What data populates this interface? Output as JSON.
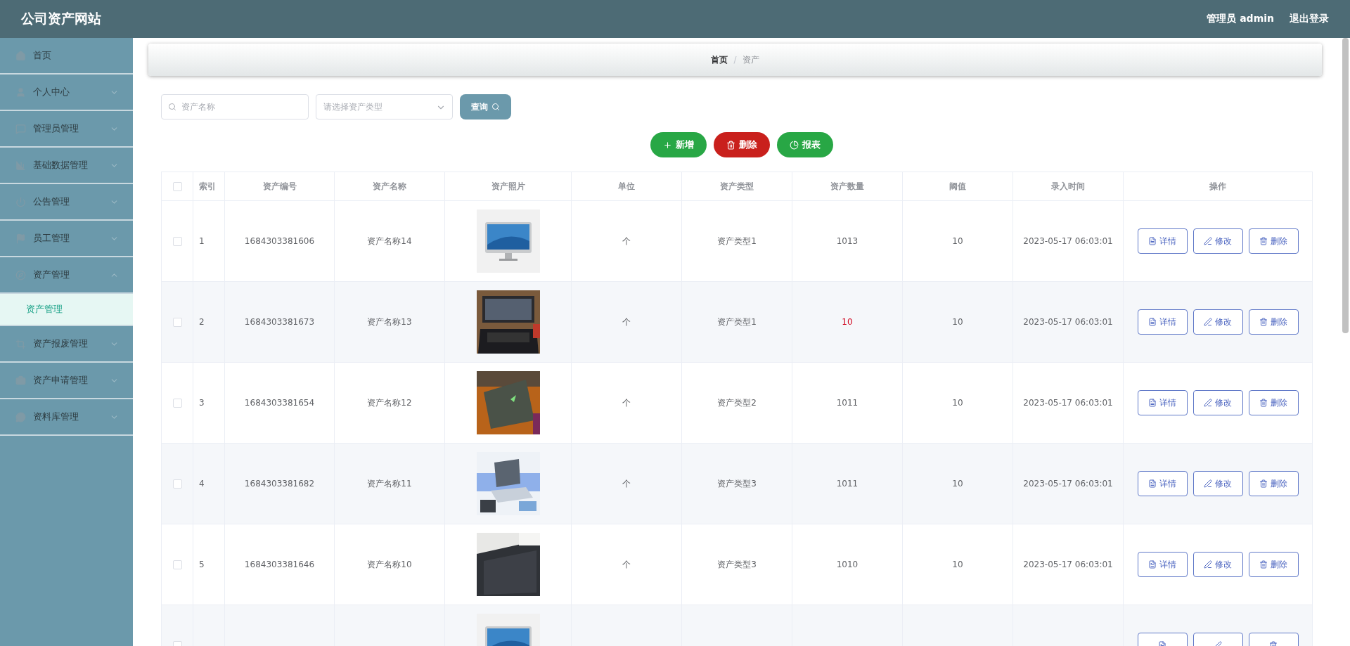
{
  "header": {
    "title": "公司资产网站",
    "user": "管理员 admin",
    "logout": "退出登录"
  },
  "sidebar": {
    "items": [
      {
        "kind": "home",
        "label": "首页"
      },
      {
        "kind": "user",
        "label": "个人中心",
        "expanded": false
      },
      {
        "kind": "chat",
        "label": "管理员管理",
        "expanded": false
      },
      {
        "kind": "chart",
        "label": "基础数据管理",
        "expanded": false
      },
      {
        "kind": "power",
        "label": "公告管理",
        "expanded": false
      },
      {
        "kind": "flag",
        "label": "员工管理",
        "expanded": false
      },
      {
        "kind": "compass",
        "label": "资产管理",
        "expanded": true,
        "children": [
          {
            "label": "资产管理",
            "selected": true
          }
        ]
      },
      {
        "kind": "crop",
        "label": "资产报废管理",
        "expanded": false
      },
      {
        "kind": "bag",
        "label": "资产申请管理",
        "expanded": false
      },
      {
        "kind": "message",
        "label": "资料库管理",
        "expanded": false
      }
    ]
  },
  "breadcrumb": {
    "items": [
      "首页",
      "资产"
    ],
    "separator": "/"
  },
  "search": {
    "name_placeholder": "资产名称",
    "type_placeholder": "请选择资产类型",
    "button": "查询"
  },
  "actions": [
    {
      "kind": "add",
      "label": "新增"
    },
    {
      "kind": "delete",
      "label": "删除"
    },
    {
      "kind": "report",
      "label": "报表"
    }
  ],
  "table": {
    "select_all_checked": false,
    "columns": [
      "索引",
      "资产编号",
      "资产名称",
      "资产照片",
      "单位",
      "资产类型",
      "资产数量",
      "阈值",
      "录入时间",
      "操作"
    ],
    "rows": [
      {
        "index": "1",
        "code": "1684303381606",
        "name": "资产名称14",
        "unit": "个",
        "type": "资产类型1",
        "quantity": "1013",
        "alert": false,
        "threshold": "10",
        "time": "2023-05-17 06:03:01",
        "checked": false,
        "buttons": [
          {
            "kind": "detail",
            "label": "详情"
          },
          {
            "kind": "edit",
            "label": "修改"
          },
          {
            "kind": "delete",
            "label": "删除"
          }
        ]
      },
      {
        "index": "2",
        "code": "1684303381673",
        "name": "资产名称13",
        "unit": "个",
        "type": "资产类型1",
        "quantity": "10",
        "alert": true,
        "threshold": "10",
        "time": "2023-05-17 06:03:01",
        "checked": false,
        "buttons": [
          {
            "kind": "detail",
            "label": "详情"
          },
          {
            "kind": "edit",
            "label": "修改"
          },
          {
            "kind": "delete",
            "label": "删除"
          }
        ]
      },
      {
        "index": "3",
        "code": "1684303381654",
        "name": "资产名称12",
        "unit": "个",
        "type": "资产类型2",
        "quantity": "1011",
        "alert": false,
        "threshold": "10",
        "time": "2023-05-17 06:03:01",
        "checked": false,
        "buttons": [
          {
            "kind": "detail",
            "label": "详情"
          },
          {
            "kind": "edit",
            "label": "修改"
          },
          {
            "kind": "delete",
            "label": "删除"
          }
        ]
      },
      {
        "index": "4",
        "code": "1684303381682",
        "name": "资产名称11",
        "unit": "个",
        "type": "资产类型3",
        "quantity": "1011",
        "alert": false,
        "threshold": "10",
        "time": "2023-05-17 06:03:01",
        "checked": false,
        "buttons": [
          {
            "kind": "detail",
            "label": "详情"
          },
          {
            "kind": "edit",
            "label": "修改"
          },
          {
            "kind": "delete",
            "label": "删除"
          }
        ]
      },
      {
        "index": "5",
        "code": "1684303381646",
        "name": "资产名称10",
        "unit": "个",
        "type": "资产类型3",
        "quantity": "1010",
        "alert": false,
        "threshold": "10",
        "time": "2023-05-17 06:03:01",
        "checked": false,
        "buttons": [
          {
            "kind": "detail",
            "label": "详情"
          },
          {
            "kind": "edit",
            "label": "修改"
          },
          {
            "kind": "delete",
            "label": "删除"
          }
        ]
      },
      {
        "checked": false,
        "buttons": [
          {
            "kind": "detail"
          },
          {
            "kind": "edit"
          },
          {
            "kind": "delete"
          }
        ]
      }
    ]
  }
}
